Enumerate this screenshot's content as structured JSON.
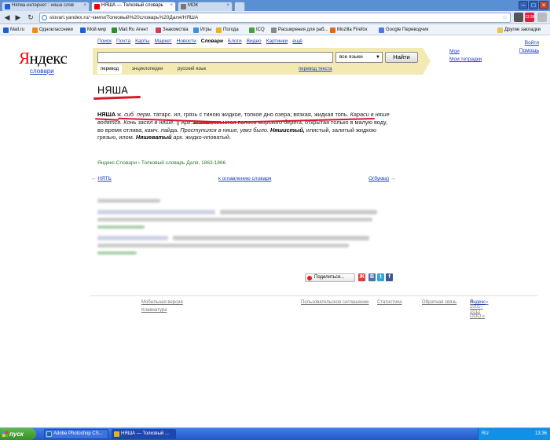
{
  "browser": {
    "tabs": [
      {
        "label": "Нягма-интернет : няша слов"
      },
      {
        "label": "НЯША — Толковый словарь"
      },
      {
        "label": "МОК"
      }
    ],
    "url": "slovari.yandex.ru/~книги/Толковый%20словарь%20Даля/НЯША",
    "badge": "13:36",
    "bookmarks": [
      {
        "label": "Mail.ru",
        "color": "#1f5ed6"
      },
      {
        "label": "Одноклассники",
        "color": "#f08a1c"
      },
      {
        "label": "Мой мир",
        "color": "#1f5ed6"
      },
      {
        "label": "Mail.Ru Агент",
        "color": "#2a8f2a"
      },
      {
        "label": "Знакомства",
        "color": "#d23a5a"
      },
      {
        "label": "Игры",
        "color": "#3b8ee0"
      },
      {
        "label": "Погода",
        "color": "#e9b422"
      },
      {
        "label": "ICQ",
        "color": "#46a03c"
      },
      {
        "label": "Расширения для раб...",
        "color": "#888888"
      },
      {
        "label": "Mozilla Firefox",
        "color": "#e06a1c"
      },
      {
        "label": "Google Переводчик",
        "color": "#4a7adc"
      }
    ],
    "other_bookmarks": "Другие закладки"
  },
  "header": {
    "logo_first": "Я",
    "logo_rest": "ндекс",
    "logo_sub": "словари",
    "nav": [
      "Поиск",
      "Почта",
      "Карты",
      "Маркет",
      "Новости",
      "Словари",
      "Блоги",
      "Видео",
      "Картинки",
      "ещё"
    ],
    "current_nav": "Словари"
  },
  "search": {
    "query": "",
    "lang": "все языки",
    "button": "Найти",
    "tabs": [
      "перевод",
      "энциклопедии",
      "русский язык"
    ],
    "link": "перевод текста"
  },
  "right_links": [
    "Мои",
    "Мои тетрадки"
  ],
  "account": {
    "login": "Войти",
    "help": "Помощь"
  },
  "article": {
    "headword": "НЯША",
    "p1_word": "НЯША",
    "p1_a": " ж. ",
    "p1_b": "сиб. перм.",
    "p1_c": " татарс. ил, грязь с тиною жидкое, топкое дно озера; вязкая, жидкая топь. ",
    "p1_d": "Караси в няше водятся. Конь засел в няше.",
    "p1_e": " || ",
    "p1_f": "Арх.",
    "p1_g": " вязкая, илистая полоса морского берега, открытая только в малую воду, во время отлива, ",
    "p1_h": "камч.",
    "p1_i": " лайда. ",
    "p1_j": "Проступился в няше, увяз было.",
    "p1_k": " ",
    "p1_l": "Няшистый,",
    "p1_m": " илистый, залитый жидкою грязью, илом. ",
    "p1_n": "Няшеватый",
    "p1_o": " ",
    "p1_p": "арх.",
    "p1_q": " жидко-иловатый.",
    "source_a": "Яндекс.Словари",
    "source_sep": " › ",
    "source_b": "Толковый словарь Даля, 1863-1866"
  },
  "pager": {
    "prev": "НЯТЬ",
    "toc": "к оглавлению словаря",
    "next": "О(буква)"
  },
  "share": {
    "label": "Поделиться..."
  },
  "social": [
    {
      "letter": "Ж",
      "color": "#e23b3b"
    },
    {
      "letter": "В",
      "color": "#4b6fa8"
    },
    {
      "letter": "t",
      "color": "#31a6d6"
    },
    {
      "letter": "f",
      "color": "#3b5998"
    }
  ],
  "footer": {
    "mobile": "Мобильная версия",
    "keyboard": "Клавиатура",
    "agreement": "Пользовательское соглашение",
    "stats": "Статистика",
    "feedback": "Обратная связь",
    "copyright": "© 2001–2012 ООО «",
    "company": "Яндекс",
    "copyright_end": "»"
  },
  "taskbar": {
    "start": "пуск",
    "tasks": [
      {
        "label": "Adobe Photoshop CS...",
        "color": "#2a5fa8"
      },
      {
        "label": "НЯША — Толковый ...",
        "color": "#e0b22a"
      }
    ],
    "lang": "RU",
    "clock": "13:36"
  }
}
